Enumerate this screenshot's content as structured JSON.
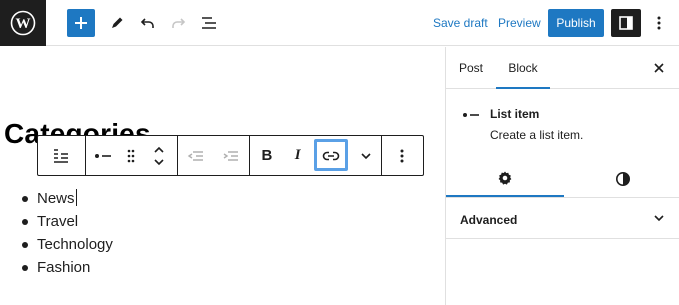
{
  "topbar": {
    "save_draft": "Save draft",
    "preview": "Preview",
    "publish": "Publish",
    "icons": [
      "wordpress-logo",
      "plus-icon",
      "pencil-icon",
      "undo-icon",
      "redo-icon",
      "list-view-icon",
      "sidebar-toggle-icon",
      "more-vertical-icon"
    ]
  },
  "canvas": {
    "heading": "Categories",
    "block_toolbar": {
      "icons": [
        "list-block-icon",
        "list-item-icon",
        "drag-handle-icon",
        "move-up-icon",
        "move-down-icon",
        "outdent-icon",
        "indent-icon",
        "bold-icon",
        "italic-icon",
        "link-icon",
        "more-rich-text-icon",
        "options-icon"
      ],
      "bold_glyph": "B",
      "italic_glyph": "I",
      "highlighted": "link-icon"
    },
    "list_items": [
      "News",
      "Travel",
      "Technology",
      "Fashion"
    ]
  },
  "sidebar": {
    "tabs": [
      "Post",
      "Block"
    ],
    "active_tab": "Block",
    "block": {
      "title": "List item",
      "description": "Create a list item."
    },
    "style_tabs": [
      "settings-icon",
      "styles-icon"
    ],
    "advanced_label": "Advanced"
  },
  "colors": {
    "accent": "#1e78c2",
    "highlight": "#5aa0e6",
    "dark": "#1e1e1e"
  }
}
